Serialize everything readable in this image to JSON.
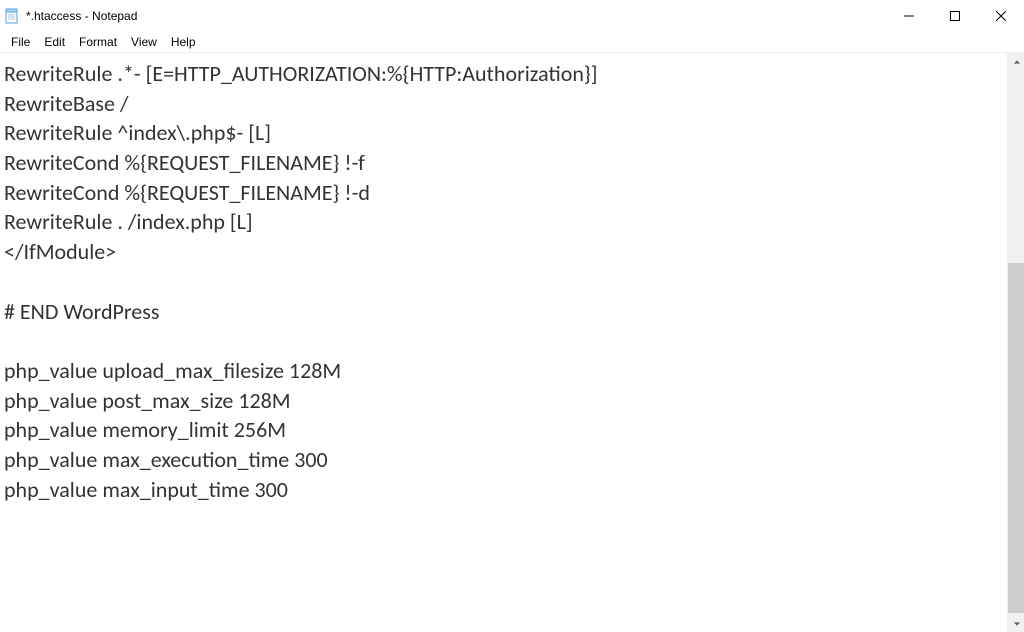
{
  "window": {
    "title": "*.htaccess - Notepad"
  },
  "menu": {
    "file": "File",
    "edit": "Edit",
    "format": "Format",
    "view": "View",
    "help": "Help"
  },
  "editor": {
    "content": "RewriteRule .*- [E=HTTP_AUTHORIZATION:%{HTTP:Authorization}]\nRewriteBase /\nRewriteRule ^index\\.php$- [L]\nRewriteCond %{REQUEST_FILENAME} !-f\nRewriteCond %{REQUEST_FILENAME} !-d\nRewriteRule . /index.php [L]\n</IfModule>\n\n# END WordPress\n\nphp_value upload_max_filesize 128M\nphp_value post_max_size 128M\nphp_value memory_limit 256M\nphp_value max_execution_time 300\nphp_value max_input_time 300"
  }
}
